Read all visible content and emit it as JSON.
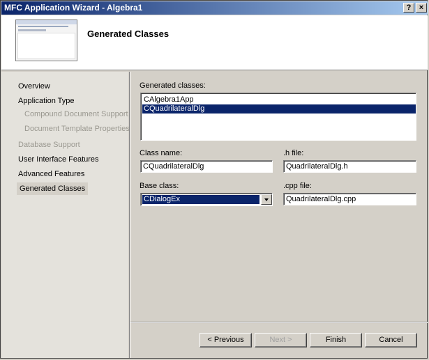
{
  "window": {
    "title": "MFC Application Wizard - Algebra1",
    "help_label": "?",
    "close_label": "×"
  },
  "header": {
    "title": "Generated Classes"
  },
  "sidebar": {
    "items": [
      {
        "label": "Overview",
        "state": "enabled"
      },
      {
        "label": "Application Type",
        "state": "enabled"
      },
      {
        "label": "Compound Document Support",
        "state": "disabled"
      },
      {
        "label": "Document Template Properties",
        "state": "disabled"
      },
      {
        "label": "Database Support",
        "state": "disabled"
      },
      {
        "label": "User Interface Features",
        "state": "enabled"
      },
      {
        "label": "Advanced Features",
        "state": "enabled"
      },
      {
        "label": "Generated Classes",
        "state": "selected"
      }
    ]
  },
  "form": {
    "classes_label": "Generated classes:",
    "classes": [
      "CAlgebra1App",
      "CQuadrilateralDlg"
    ],
    "selected_class_index": 1,
    "class_name_label": "Class name:",
    "class_name_value": "CQuadrilateralDlg",
    "h_file_label": ".h file:",
    "h_file_value": "QuadrilateralDlg.h",
    "base_class_label": "Base class:",
    "base_class_value": "CDialogEx",
    "cpp_file_label": ".cpp file:",
    "cpp_file_value": "QuadrilateralDlg.cpp"
  },
  "buttons": {
    "previous": "< Previous",
    "next": "Next >",
    "finish": "Finish",
    "cancel": "Cancel"
  },
  "colors": {
    "title_start": "#0a246a",
    "title_end": "#a6caf0",
    "selection": "#0a246a",
    "dialog_bg": "#d4d0c8"
  }
}
